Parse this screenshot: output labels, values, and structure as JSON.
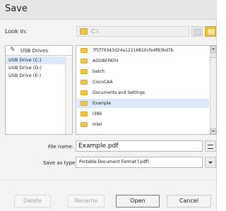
{
  "window": {
    "title": "Save"
  },
  "look_in": {
    "label": "Look in:",
    "path": "C:\\"
  },
  "drives": {
    "header": "USB Drives",
    "items": [
      {
        "label": "USB Drive (C:)",
        "selected": true
      },
      {
        "label": "USB Drive (D:)",
        "selected": false
      },
      {
        "label": "USB Drive (E:)",
        "selected": false
      }
    ]
  },
  "files": [
    {
      "name": "7f1f79343d24a12216810cfe4f83bd7b",
      "selected": false
    },
    {
      "name": "ADOBEPATH",
      "selected": false
    },
    {
      "name": "batch",
      "selected": false
    },
    {
      "name": "CiscoCAA",
      "selected": false
    },
    {
      "name": "Documents and Settings",
      "selected": false
    },
    {
      "name": "Example",
      "selected": true
    },
    {
      "name": "I386",
      "selected": false
    },
    {
      "name": "Intel",
      "selected": false
    }
  ],
  "file_name": {
    "label": "File name:",
    "value": "Example.pdf"
  },
  "save_as_type": {
    "label": "Save as type:",
    "value": "Portable Document Format (.pdf)"
  },
  "buttons": {
    "delete": "Delete",
    "rename": "Rename",
    "open": "Open",
    "cancel": "Cancel"
  },
  "colors": {
    "selection": "#dbe8f8",
    "folder": "#f1c54d"
  }
}
